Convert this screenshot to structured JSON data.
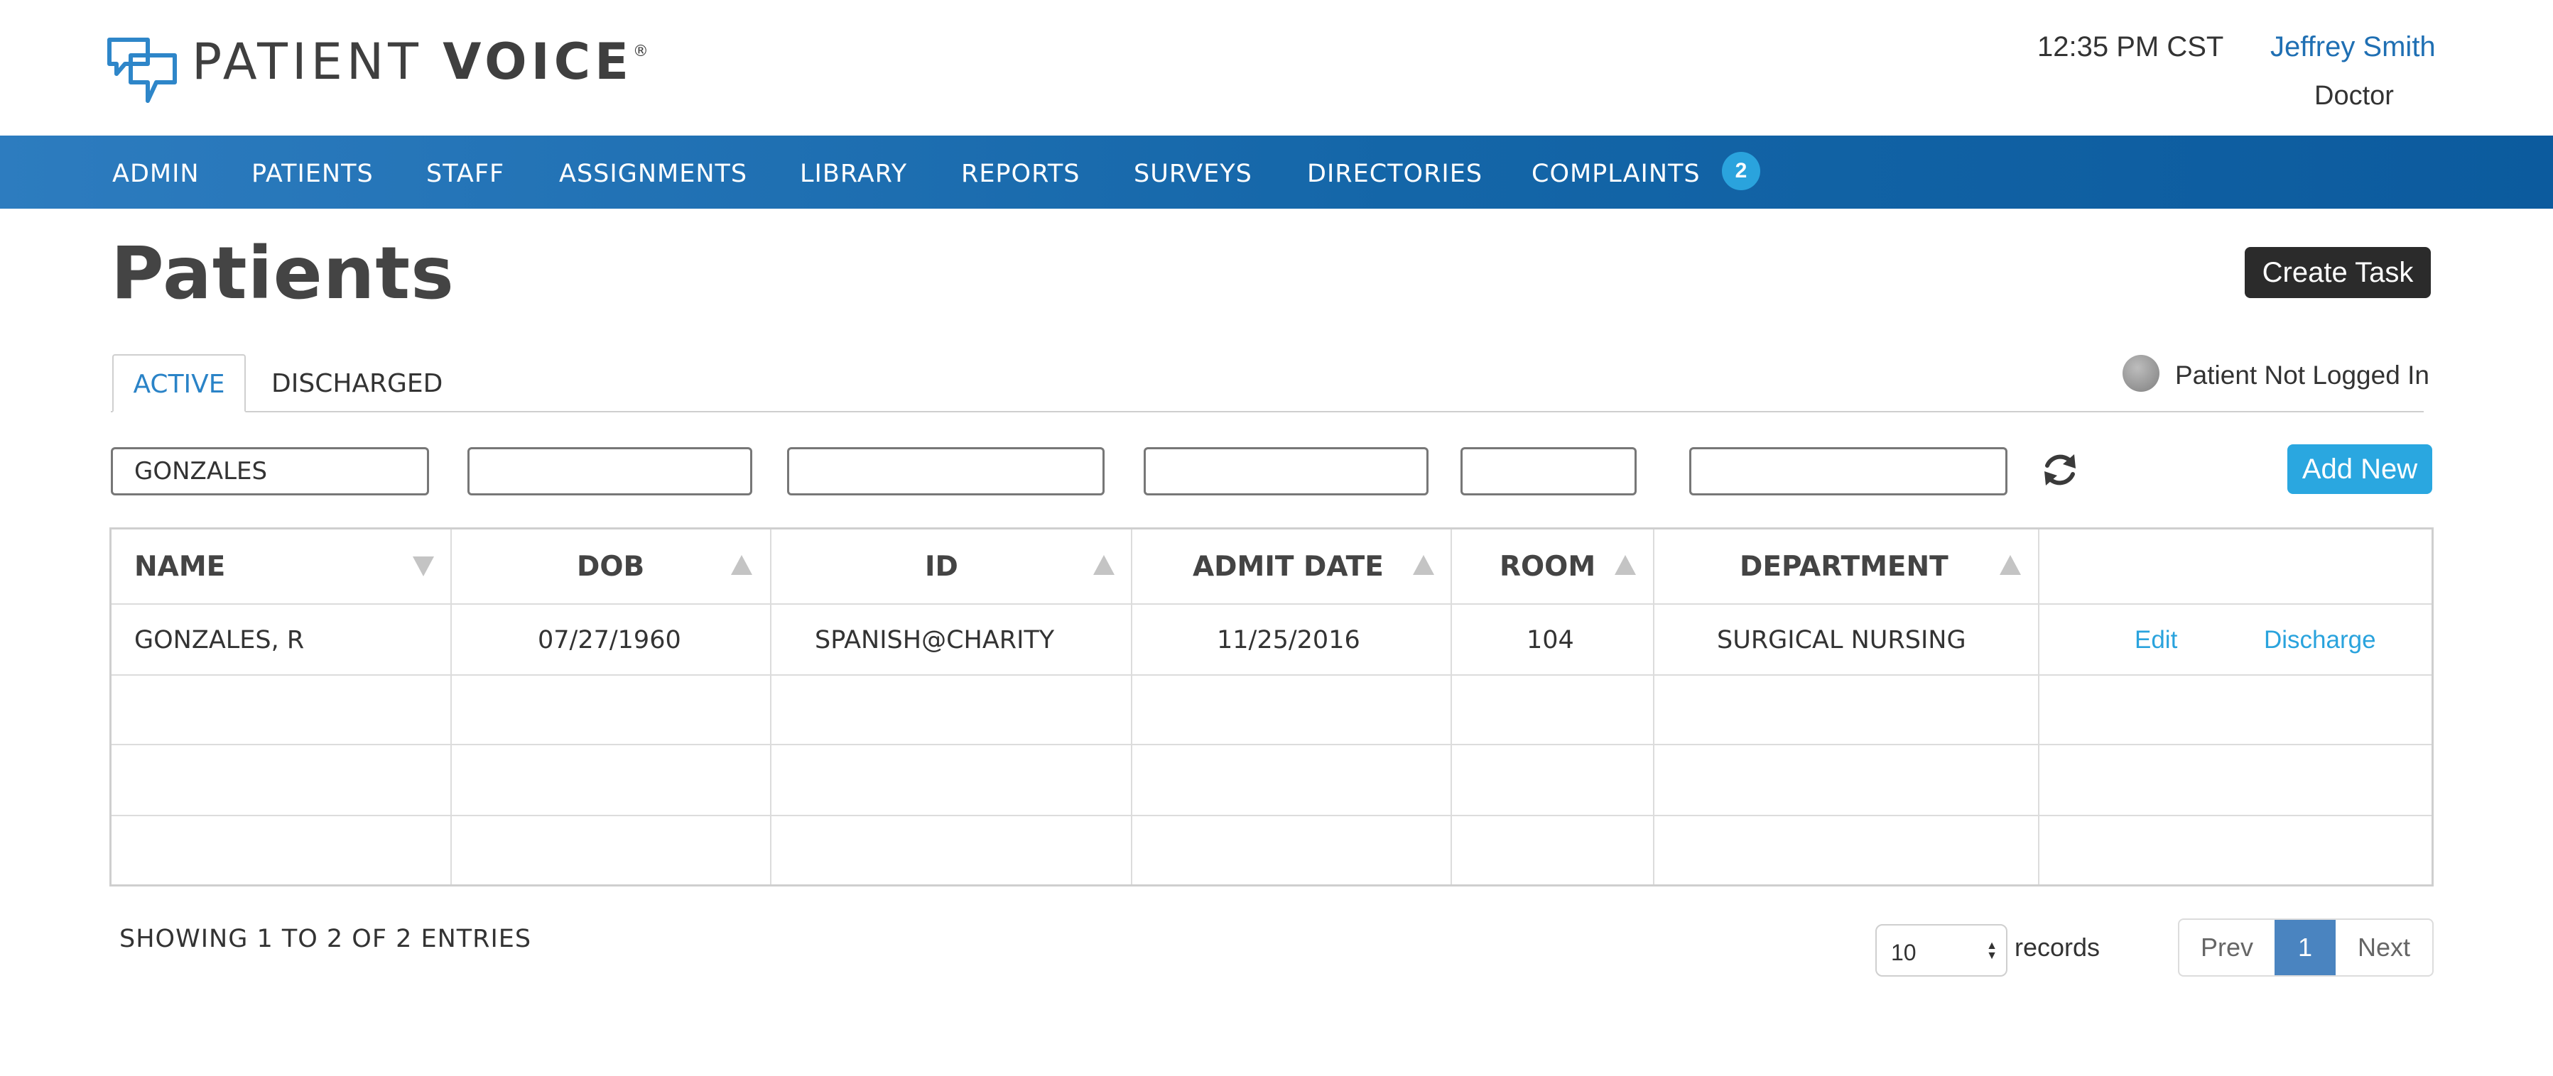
{
  "brand": {
    "name_light": "PATIENT ",
    "name_bold": "VOICE",
    "registered": "®"
  },
  "header": {
    "time": "12:35 PM CST",
    "user_name": "Jeffrey Smith",
    "user_role": "Doctor"
  },
  "nav": {
    "items": [
      "ADMIN",
      "PATIENTS",
      "STAFF",
      "ASSIGNMENTS",
      "LIBRARY",
      "REPORTS",
      "SURVEYS",
      "DIRECTORIES",
      "COMPLAINTS"
    ],
    "complaints_badge": "2"
  },
  "page": {
    "title": "Patients",
    "create_task_label": "Create Task"
  },
  "tabs": {
    "active_label": "ACTIVE",
    "discharged_label": "DISCHARGED"
  },
  "status_legend": {
    "label": "Patient Not Logged In"
  },
  "filters": {
    "name_value": "GONZALES",
    "dob_value": "",
    "id_value": "",
    "admit_date_value": "",
    "room_value": "",
    "department_value": ""
  },
  "actions": {
    "add_new_label": "Add New"
  },
  "table": {
    "columns": [
      "NAME",
      "DOB",
      "ID",
      "ADMIT DATE",
      "ROOM",
      "DEPARTMENT"
    ],
    "rows": [
      {
        "name": "GONZALES, R",
        "dob": "07/27/1960",
        "id": "SPANISH@CHARITY",
        "admit_date": "11/25/2016",
        "room": "104",
        "department": "SURGICAL NURSING",
        "edit_label": "Edit",
        "discharge_label": "Discharge"
      }
    ]
  },
  "footer": {
    "showing_text": "SHOWING 1 TO 2 OF 2 ENTRIES",
    "page_size": "10",
    "records_label": "records",
    "prev_label": "Prev",
    "current_page": "1",
    "next_label": "Next"
  },
  "colors": {
    "nav_blue": "#1466a8",
    "accent_blue": "#2aa7e0",
    "link_blue": "#2aa3dd",
    "dark_button": "#2b2b2b",
    "current_page": "#4a84c0"
  }
}
